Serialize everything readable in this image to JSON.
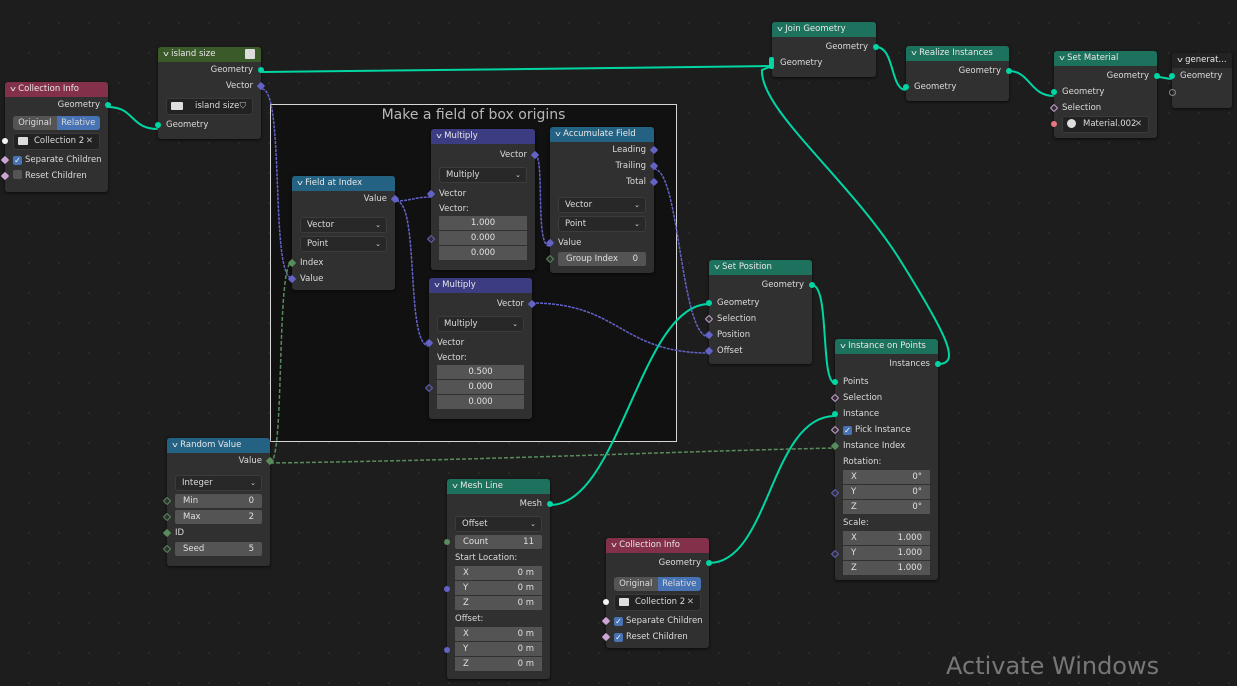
{
  "frame": {
    "title": "Make a field of box origins"
  },
  "colors": {
    "geometry_wire": "#00d6a3",
    "vector_wire": "#6363c7",
    "int_wire": "#598c5c",
    "header_geometry": "#1d725e",
    "header_input": "#83314a",
    "header_converter": "#246283",
    "header_vector": "#3c3c83",
    "header_group": "#3b5a2a",
    "selected": "#4772b3"
  },
  "nodes": {
    "collection_info_1": {
      "title": "Collection Info",
      "out_geometry": "Geometry",
      "mode_original": "Original",
      "mode_relative": "Relative",
      "collection": "Collection 2",
      "separate_children": "Separate Children",
      "separate_checked": true,
      "reset_children": "Reset Children",
      "reset_checked": false
    },
    "island_size": {
      "title": "island size",
      "out_geometry": "Geometry",
      "out_vector": "Vector",
      "group_name": "island size",
      "in_geometry": "Geometry"
    },
    "field_at_index": {
      "title": "Field at Index",
      "out_value": "Value",
      "type": "Vector",
      "domain": "Point",
      "in_index": "Index",
      "in_value": "Value"
    },
    "multiply_1": {
      "title": "Multiply",
      "out_vector": "Vector",
      "operation": "Multiply",
      "in_vector": "Vector",
      "vector_label": "Vector:",
      "values": [
        "1.000",
        "0.000",
        "0.000"
      ]
    },
    "multiply_2": {
      "title": "Multiply",
      "out_vector": "Vector",
      "operation": "Multiply",
      "in_vector": "Vector",
      "vector_label": "Vector:",
      "values": [
        "0.500",
        "0.000",
        "0.000"
      ]
    },
    "accumulate_field": {
      "title": "Accumulate Field",
      "out_leading": "Leading",
      "out_trailing": "Trailing",
      "out_total": "Total",
      "type": "Vector",
      "domain": "Point",
      "in_value": "Value",
      "group_index_label": "Group Index",
      "group_index": "0"
    },
    "random_value": {
      "title": "Random Value",
      "out_value": "Value",
      "type": "Integer",
      "min_label": "Min",
      "min": "0",
      "max_label": "Max",
      "max": "2",
      "id_label": "ID",
      "seed_label": "Seed",
      "seed": "5"
    },
    "join_geometry": {
      "title": "Join Geometry",
      "out_geometry": "Geometry",
      "in_geometry": "Geometry"
    },
    "realize_instances": {
      "title": "Realize Instances",
      "out_geometry": "Geometry",
      "in_geometry": "Geometry"
    },
    "set_material": {
      "title": "Set Material",
      "out_geometry": "Geometry",
      "in_geometry": "Geometry",
      "in_selection": "Selection",
      "material": "Material.002"
    },
    "group_output": {
      "title": "generat...",
      "in_geometry": "Geometry"
    },
    "set_position": {
      "title": "Set Position",
      "out_geometry": "Geometry",
      "in_geometry": "Geometry",
      "in_selection": "Selection",
      "in_position": "Position",
      "in_offset": "Offset"
    },
    "instance_on_points": {
      "title": "Instance on Points",
      "out_instances": "Instances",
      "in_points": "Points",
      "in_selection": "Selection",
      "in_instance": "Instance",
      "pick_instance": "Pick Instance",
      "pick_checked": true,
      "in_instance_index": "Instance Index",
      "rotation_label": "Rotation:",
      "rotation": [
        {
          "axis": "X",
          "value": "0°"
        },
        {
          "axis": "Y",
          "value": "0°"
        },
        {
          "axis": "Z",
          "value": "0°"
        }
      ],
      "scale_label": "Scale:",
      "scale": [
        {
          "axis": "X",
          "value": "1.000"
        },
        {
          "axis": "Y",
          "value": "1.000"
        },
        {
          "axis": "Z",
          "value": "1.000"
        }
      ]
    },
    "mesh_line": {
      "title": "Mesh Line",
      "out_mesh": "Mesh",
      "mode": "Offset",
      "count_label": "Count",
      "count": "11",
      "start_label": "Start Location:",
      "start": [
        {
          "axis": "X",
          "value": "0 m"
        },
        {
          "axis": "Y",
          "value": "0 m"
        },
        {
          "axis": "Z",
          "value": "0 m"
        }
      ],
      "offset_label": "Offset:",
      "offset": [
        {
          "axis": "X",
          "value": "0 m"
        },
        {
          "axis": "Y",
          "value": "0 m"
        },
        {
          "axis": "Z",
          "value": "0 m"
        }
      ]
    },
    "collection_info_2": {
      "title": "Collection Info",
      "out_geometry": "Geometry",
      "mode_original": "Original",
      "mode_relative": "Relative",
      "collection": "Collection 2",
      "separate_children": "Separate Children",
      "separate_checked": true,
      "reset_children": "Reset Children",
      "reset_checked": true
    }
  },
  "watermark": "Activate Windows"
}
